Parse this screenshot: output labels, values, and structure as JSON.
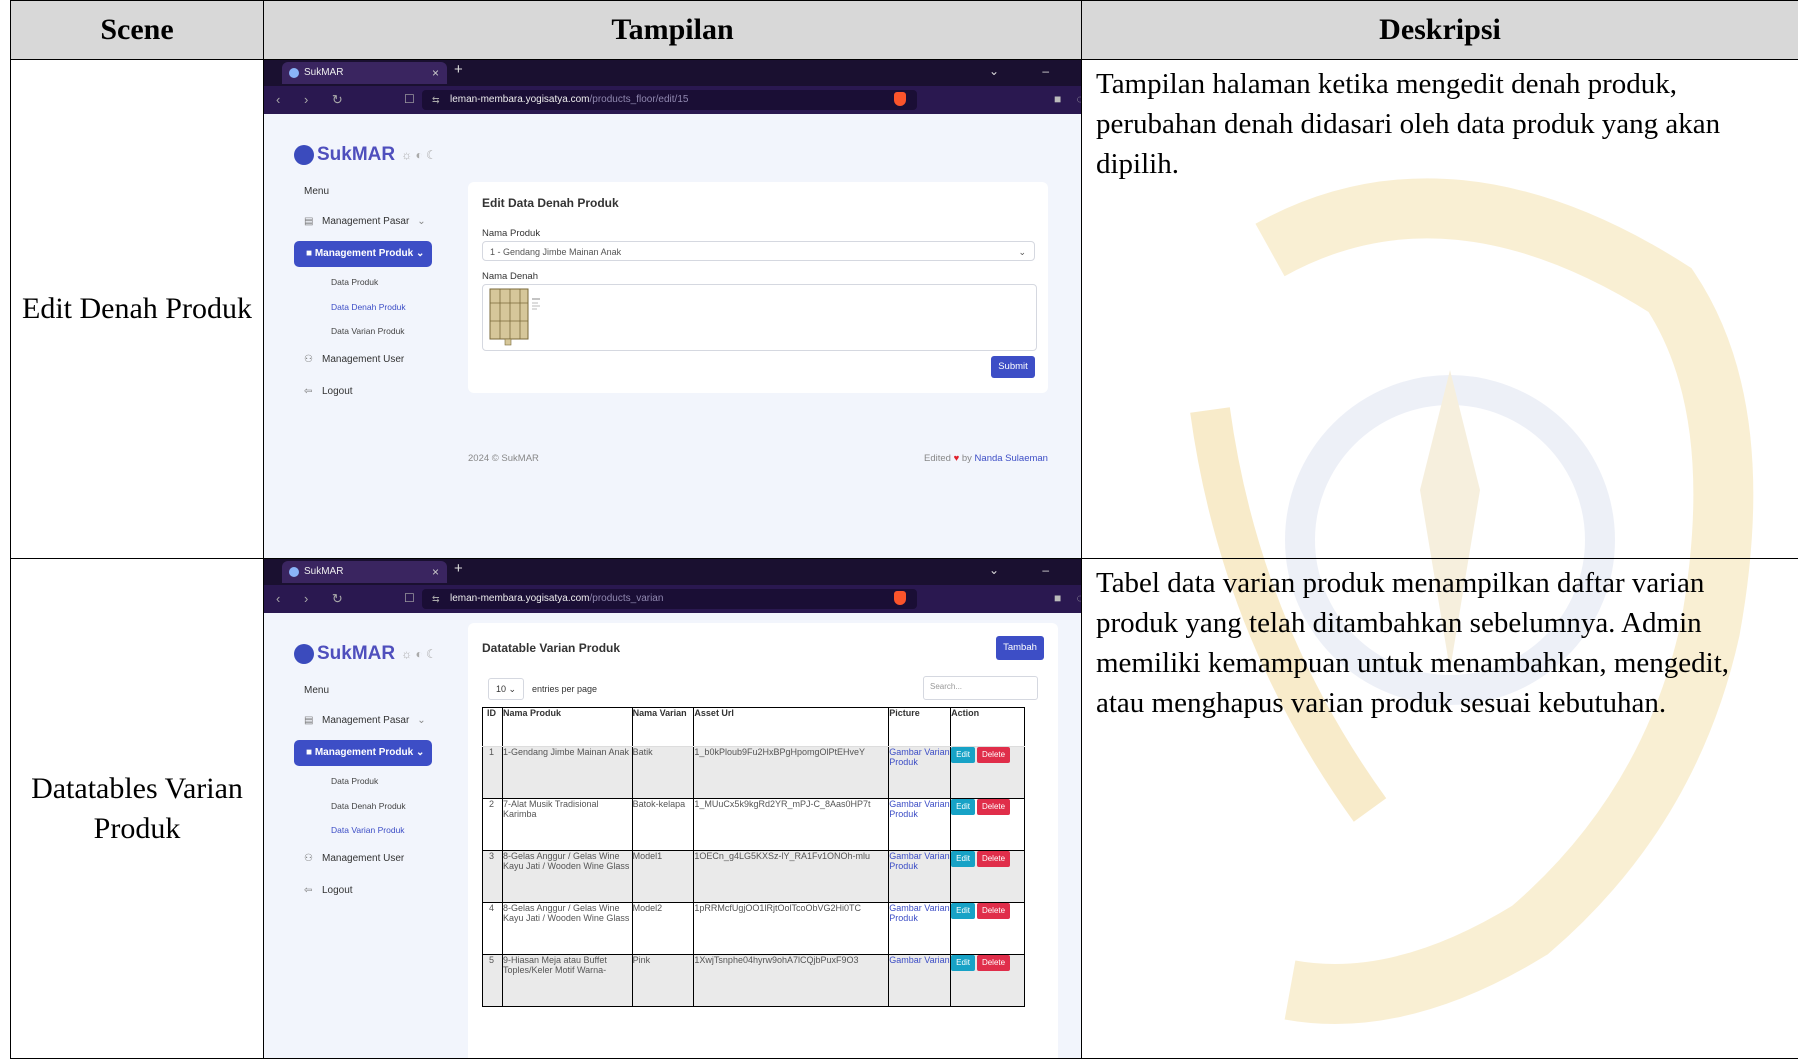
{
  "table": {
    "headers": [
      "Scene",
      "Tampilan",
      "Deskripsi"
    ],
    "rows": [
      {
        "scene": "Edit Denah Produk",
        "description": "Tampilan halaman ketika mengedit denah produk, perubahan denah didasari oleh data produk yang akan dipilih."
      },
      {
        "scene": "Datatables Varian Produk",
        "description": "Tabel data varian produk menampilkan daftar varian produk yang telah ditambahkan sebelumnya. Admin memiliki kemampuan untuk menambahkan, mengedit, atau menghapus varian produk sesuai kebutuhan."
      }
    ]
  },
  "browser": {
    "tab_title": "SukMAR",
    "url_host": "leman-membara.yogisatya.com",
    "url_path_1": "/products_floor/edit/15",
    "url_path_2": "/products_varian"
  },
  "app": {
    "logo": "SukMAR",
    "menu_header": "Menu",
    "menu": {
      "pasar": "Management Pasar",
      "produk": "Management Produk",
      "sub_data_produk": "Data Produk",
      "sub_data_denah": "Data Denah Produk",
      "sub_data_varian": "Data Varian Produk",
      "user": "Management User",
      "logout": "Logout"
    }
  },
  "screen1": {
    "card_title": "Edit Data Denah Produk",
    "label_nama_produk": "Nama Produk",
    "selected_produk": "1 - Gendang Jimbe Mainan Anak",
    "label_nama_denah": "Nama Denah",
    "submit": "Submit",
    "footer_left": "2024 © SukMAR",
    "footer_edited": "Edited",
    "footer_by": "by",
    "footer_name": "Nanda Sulaeman"
  },
  "screen2": {
    "card_title": "Datatable Varian Produk",
    "tambah": "Tambah",
    "entries_value": "10",
    "entries_label": "entries per page",
    "search_placeholder": "Search...",
    "columns": [
      "ID",
      "Nama Produk",
      "Nama Varian",
      "Asset Url",
      "Picture",
      "Action"
    ],
    "rows": [
      {
        "id": "1",
        "nama": "1-Gendang Jimbe Mainan Anak",
        "varian": "Batik",
        "asset": "1_b0kPloub9Fu2HxBPgHpomgOlPtEHveY",
        "picture": "Gambar Varian Produk"
      },
      {
        "id": "2",
        "nama": "7-Alat Musik Tradisional Karimba",
        "varian": "Batok-kelapa",
        "asset": "1_MUuCx5k9kgRd2YR_mPJ-C_8Aas0HP7t",
        "picture": "Gambar Varian Produk"
      },
      {
        "id": "3",
        "nama": "8-Gelas Anggur / Gelas Wine Kayu Jati / Wooden Wine Glass",
        "varian": "Model1",
        "asset": "1OECn_g4LG5KXSz-lY_RA1Fv1ONOh-mlu",
        "picture": "Gambar Varian Produk"
      },
      {
        "id": "4",
        "nama": "8-Gelas Anggur / Gelas Wine Kayu Jati / Wooden Wine Glass",
        "varian": "Model2",
        "asset": "1pRRMcfUgjOO1lRjtOolTcoObVG2Hi0TC",
        "picture": "Gambar Varian Produk"
      },
      {
        "id": "5",
        "nama": "9-Hiasan Meja atau Buffet Toples/Keler Motif Warna-",
        "varian": "Pink",
        "asset": "1XwjTsnphe04hyrw9ohA7lCQjbPuxF9O3",
        "picture": "Gambar Varian"
      }
    ],
    "edit": "Edit",
    "delete": "Delete"
  }
}
